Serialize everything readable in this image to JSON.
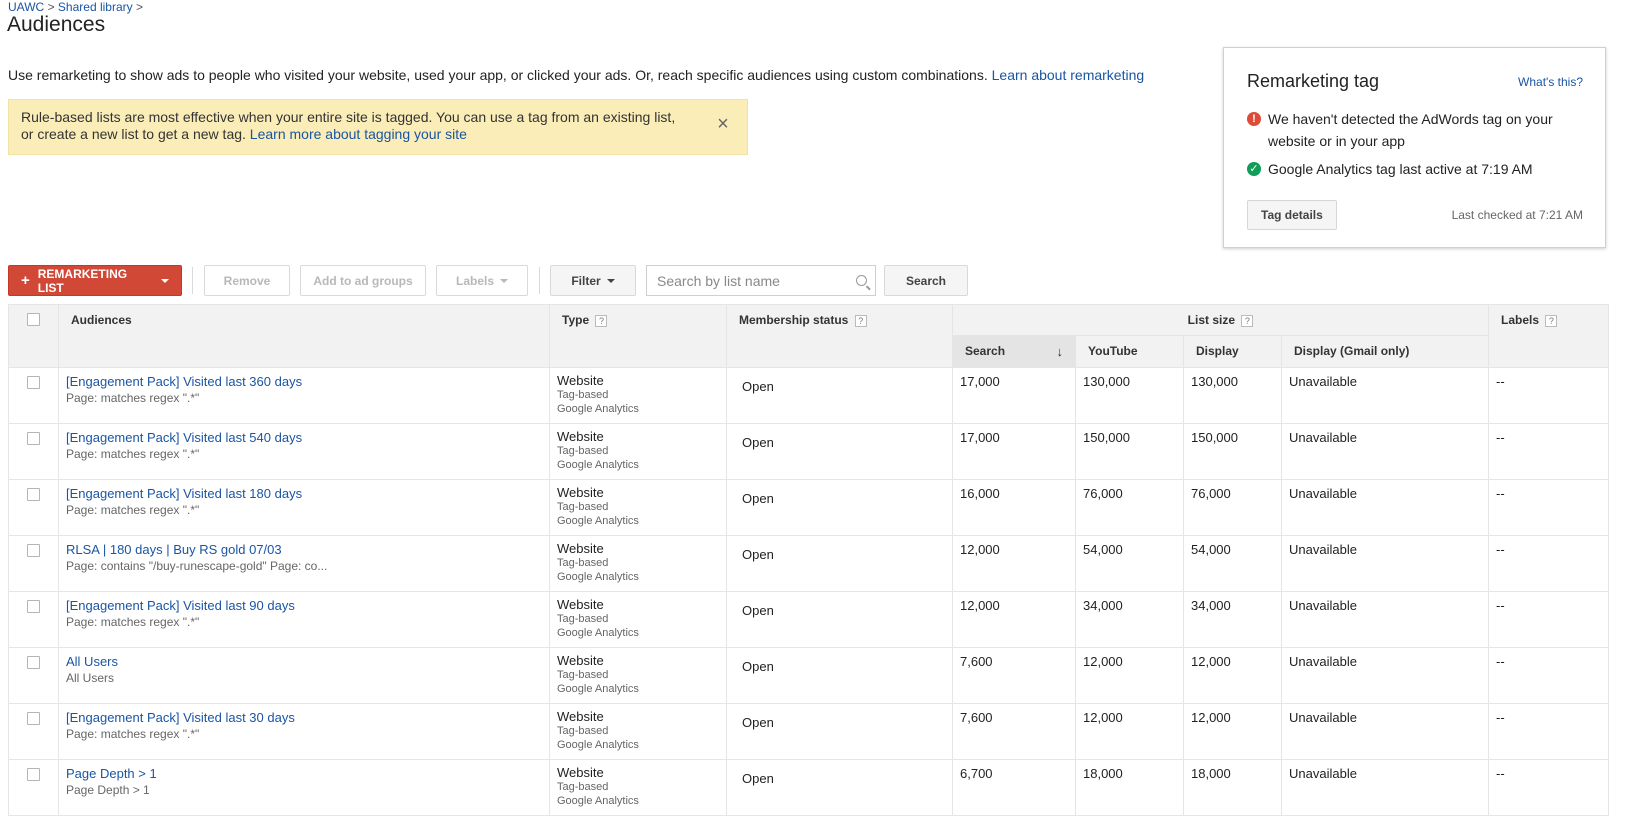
{
  "breadcrumb": {
    "account": "UAWC",
    "library": "Shared library",
    "sep": ">"
  },
  "page_title": "Audiences",
  "intro": {
    "text": "Use remarketing to show ads to people who visited your website, used your app, or clicked your ads. Or, reach specific audiences using custom combinations.",
    "link": "Learn about remarketing"
  },
  "notice": {
    "text": "Rule-based lists are most effective when your entire site is tagged. You can use a tag from an existing list, or create a new list to get a new tag.",
    "link": "Learn more about tagging your site",
    "close_glyph": "×"
  },
  "tag_card": {
    "title": "Remarketing tag",
    "whats_this": "What's this?",
    "status_error": "We haven't detected the AdWords tag on your website or in your app",
    "status_ok": "Google Analytics tag last active at 7:19 AM",
    "tag_details": "Tag details",
    "last_checked": "Last checked at 7:21 AM",
    "error_color": "#dd4b39",
    "ok_color": "#0f9d58"
  },
  "toolbar": {
    "remarketing_list": "REMARKETING LIST",
    "remove": "Remove",
    "add_to_ad_groups": "Add to ad groups",
    "labels": "Labels",
    "filter": "Filter",
    "search_placeholder": "Search by list name",
    "search": "Search",
    "primary_color": "#d14836"
  },
  "table": {
    "headers": {
      "audiences": "Audiences",
      "type": "Type",
      "membership": "Membership status",
      "list_size": "List size",
      "labels": "Labels",
      "search": "Search",
      "youtube": "YouTube",
      "display": "Display",
      "display_gmail": "Display (Gmail only)",
      "help": "?",
      "sort_arrow": "↓"
    },
    "rows": [
      {
        "name": "[Engagement Pack] Visited last 360 days",
        "desc": "Page: matches regex \".*\"",
        "type": "Website",
        "type_sub1": "Tag-based",
        "type_sub2": "Google Analytics",
        "membership": "Open",
        "search": "17,000",
        "youtube": "130,000",
        "display": "130,000",
        "gmail": "Unavailable",
        "labels": "--"
      },
      {
        "name": "[Engagement Pack] Visited last 540 days",
        "desc": "Page: matches regex \".*\"",
        "type": "Website",
        "type_sub1": "Tag-based",
        "type_sub2": "Google Analytics",
        "membership": "Open",
        "search": "17,000",
        "youtube": "150,000",
        "display": "150,000",
        "gmail": "Unavailable",
        "labels": "--"
      },
      {
        "name": "[Engagement Pack] Visited last 180 days",
        "desc": "Page: matches regex \".*\"",
        "type": "Website",
        "type_sub1": "Tag-based",
        "type_sub2": "Google Analytics",
        "membership": "Open",
        "search": "16,000",
        "youtube": "76,000",
        "display": "76,000",
        "gmail": "Unavailable",
        "labels": "--"
      },
      {
        "name": "RLSA | 180 days | Buy RS gold 07/03",
        "desc": "Page: contains \"/buy-runescape-gold\" Page: co...",
        "type": "Website",
        "type_sub1": "Tag-based",
        "type_sub2": "Google Analytics",
        "membership": "Open",
        "search": "12,000",
        "youtube": "54,000",
        "display": "54,000",
        "gmail": "Unavailable",
        "labels": "--"
      },
      {
        "name": "[Engagement Pack] Visited last 90 days",
        "desc": "Page: matches regex \".*\"",
        "type": "Website",
        "type_sub1": "Tag-based",
        "type_sub2": "Google Analytics",
        "membership": "Open",
        "search": "12,000",
        "youtube": "34,000",
        "display": "34,000",
        "gmail": "Unavailable",
        "labels": "--"
      },
      {
        "name": "All Users",
        "desc": "All Users",
        "type": "Website",
        "type_sub1": "Tag-based",
        "type_sub2": "Google Analytics",
        "membership": "Open",
        "search": "7,600",
        "youtube": "12,000",
        "display": "12,000",
        "gmail": "Unavailable",
        "labels": "--"
      },
      {
        "name": "[Engagement Pack] Visited last 30 days",
        "desc": "Page: matches regex \".*\"",
        "type": "Website",
        "type_sub1": "Tag-based",
        "type_sub2": "Google Analytics",
        "membership": "Open",
        "search": "7,600",
        "youtube": "12,000",
        "display": "12,000",
        "gmail": "Unavailable",
        "labels": "--"
      },
      {
        "name": "Page Depth > 1",
        "desc": "Page Depth > 1",
        "type": "Website",
        "type_sub1": "Tag-based",
        "type_sub2": "Google Analytics",
        "membership": "Open",
        "search": "6,700",
        "youtube": "18,000",
        "display": "18,000",
        "gmail": "Unavailable",
        "labels": "--"
      }
    ]
  }
}
